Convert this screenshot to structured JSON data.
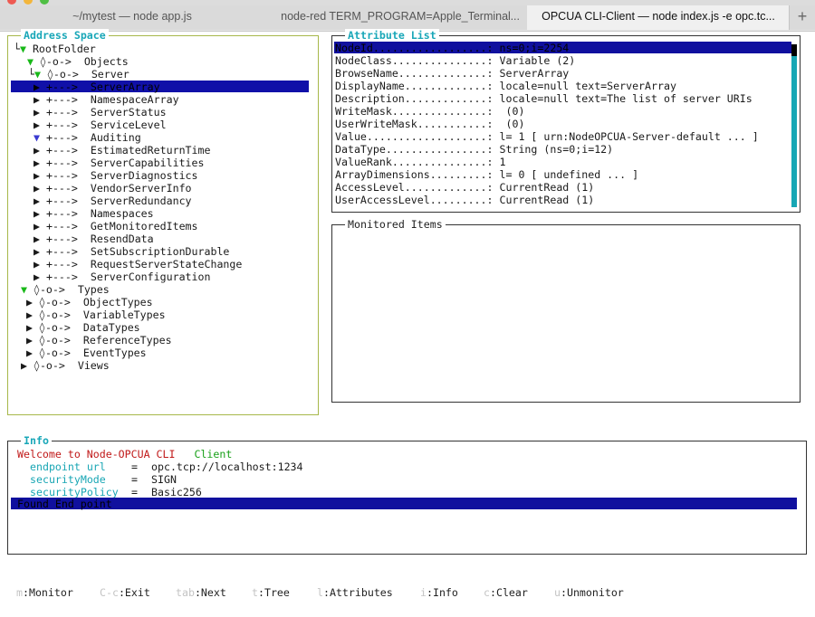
{
  "tabs": [
    {
      "label": "~/mytest — node app.js",
      "active": false
    },
    {
      "label": "node-red TERM_PROGRAM=Apple_Terminal",
      "active": false,
      "more": "..."
    },
    {
      "label": "OPCUA CLI-Client — node index.js -e opc.tc...",
      "active": true
    }
  ],
  "new_tab_icon": "+",
  "address_space": {
    "title": "Address Space",
    "root": "RootFolder",
    "objects": {
      "prefix": "◊-o->",
      "label": "Objects"
    },
    "server": {
      "prefix": "◊-o->",
      "label": "Server"
    },
    "server_children": [
      {
        "prefix": "+--->",
        "label": "ServerArray",
        "selected": true,
        "expanded": false
      },
      {
        "prefix": "+--->",
        "label": "NamespaceArray",
        "expanded": false
      },
      {
        "prefix": "+--->",
        "label": "ServerStatus",
        "expanded": false
      },
      {
        "prefix": "+--->",
        "label": "ServiceLevel",
        "expanded": false
      },
      {
        "prefix": "+--->",
        "label": "Auditing",
        "expanded": true
      },
      {
        "prefix": "+--->",
        "label": "EstimatedReturnTime",
        "expanded": false
      },
      {
        "prefix": "+--->",
        "label": "ServerCapabilities",
        "expanded": false
      },
      {
        "prefix": "+--->",
        "label": "ServerDiagnostics",
        "expanded": false
      },
      {
        "prefix": "+--->",
        "label": "VendorServerInfo",
        "expanded": false
      },
      {
        "prefix": "+--->",
        "label": "ServerRedundancy",
        "expanded": false
      },
      {
        "prefix": "+--->",
        "label": "Namespaces",
        "expanded": false
      },
      {
        "prefix": "+--->",
        "label": "GetMonitoredItems",
        "expanded": false
      },
      {
        "prefix": "+--->",
        "label": "ResendData",
        "expanded": false
      },
      {
        "prefix": "+--->",
        "label": "SetSubscriptionDurable",
        "expanded": false
      },
      {
        "prefix": "+--->",
        "label": "RequestServerStateChange",
        "expanded": false
      },
      {
        "prefix": "+--->",
        "label": "ServerConfiguration",
        "expanded": false
      }
    ],
    "types": {
      "prefix": "◊-o->",
      "label": "Types"
    },
    "types_children": [
      {
        "prefix": "◊-o->",
        "label": "ObjectTypes"
      },
      {
        "prefix": "◊-o->",
        "label": "VariableTypes"
      },
      {
        "prefix": "◊-o->",
        "label": "DataTypes"
      },
      {
        "prefix": "◊-o->",
        "label": "ReferenceTypes"
      },
      {
        "prefix": "◊-o->",
        "label": "EventTypes"
      }
    ],
    "views": {
      "prefix": "◊-o->",
      "label": "Views"
    }
  },
  "attribute_list": {
    "title": "Attribute List",
    "rows": [
      {
        "key": "NodeId..................:",
        "value": "ns=0;i=2254",
        "selected": true
      },
      {
        "key": "NodeClass...............:",
        "value": "Variable (2)"
      },
      {
        "key": "BrowseName..............:",
        "value": "ServerArray"
      },
      {
        "key": "DisplayName.............:",
        "value": "locale=null text=ServerArray"
      },
      {
        "key": "Description.............:",
        "value": "locale=null text=The list of server URIs"
      },
      {
        "key": "WriteMask...............:",
        "value": " (0)"
      },
      {
        "key": "UserWriteMask...........:",
        "value": " (0)"
      },
      {
        "key": "Value...................:",
        "value": "l= 1 [ urn:NodeOPCUA-Server-default ... ]"
      },
      {
        "key": "DataType................:",
        "value": "String (ns=0;i=12)"
      },
      {
        "key": "ValueRank...............:",
        "value": "1"
      },
      {
        "key": "ArrayDimensions.........:",
        "value": "l= 0 [ undefined ... ]"
      },
      {
        "key": "AccessLevel.............:",
        "value": "CurrentRead (1)"
      },
      {
        "key": "UserAccessLevel.........:",
        "value": "CurrentRead (1)"
      }
    ]
  },
  "monitored_items": {
    "title": "Monitored Items"
  },
  "info": {
    "title": "Info",
    "welcome": "Welcome to Node-OPCUA CLI",
    "client": "Client",
    "fields": [
      {
        "key": "endpoint url",
        "sep": "=",
        "value": "opc.tcp://localhost:1234"
      },
      {
        "key": "securityMode",
        "sep": "=",
        "value": "SIGN"
      },
      {
        "key": "securityPolicy",
        "sep": "=",
        "value": "Basic256"
      }
    ],
    "status": "Found End point"
  },
  "footer": [
    {
      "key": "m",
      "desc": ":Monitor"
    },
    {
      "key": "C-c",
      "desc": ":Exit"
    },
    {
      "key": "tab",
      "desc": ":Next"
    },
    {
      "key": "t",
      "desc": ":Tree"
    },
    {
      "key": "l",
      "desc": ":Attributes"
    },
    {
      "key": "i",
      "desc": ":Info"
    },
    {
      "key": "c",
      "desc": ":Clear"
    },
    {
      "key": "u",
      "desc": ":Unmonitor"
    }
  ],
  "colors": {
    "accent_title": "#19a7b8",
    "selection_bg": "#10109e",
    "address_border": "#a7b84a",
    "tree_triangle": "#18b818",
    "error_red": "#c01818"
  }
}
